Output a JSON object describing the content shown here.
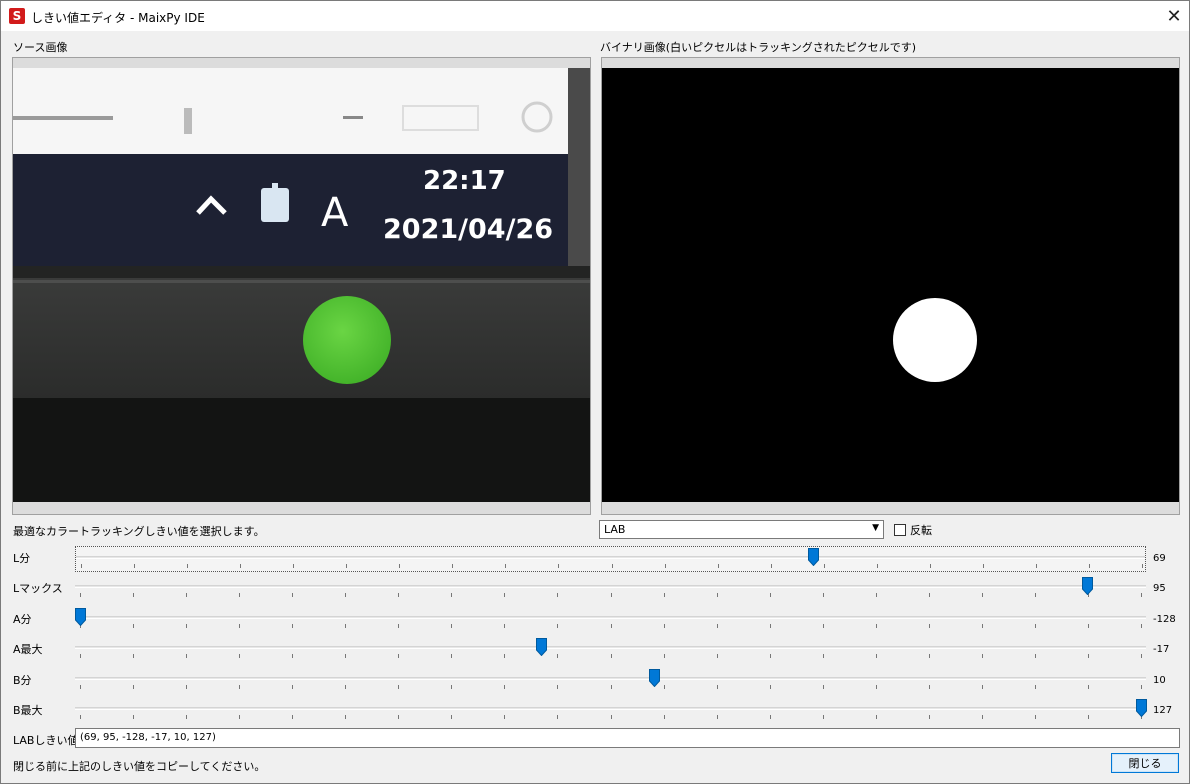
{
  "window": {
    "title": "しきい値エディタ - MaixPy IDE",
    "app_icon_letter": "S",
    "close_glyph": "✕"
  },
  "source_panel": {
    "label": "ソース画像",
    "clock_time": "22:17",
    "clock_date": "2021/04/26",
    "tray_letter": "A",
    "tray_chevron": "^"
  },
  "binary_panel": {
    "label": "バイナリ画像(白いピクセルはトラッキングされたピクセルです)"
  },
  "controls": {
    "hint": "最適なカラートラッキングしきい値を選択します。",
    "colorspace_selected": "LAB",
    "invert_label": "反転",
    "invert_checked": false
  },
  "sliders": [
    {
      "label": "L分",
      "value": "69",
      "min": 0,
      "max": 100,
      "num": 69
    },
    {
      "label": "Lマックス",
      "value": "95",
      "min": 0,
      "max": 100,
      "num": 95
    },
    {
      "label": "A分",
      "value": "-128",
      "min": -128,
      "max": 127,
      "num": -128
    },
    {
      "label": "A最大",
      "value": "-17",
      "min": -128,
      "max": 127,
      "num": -17
    },
    {
      "label": "B分",
      "value": "10",
      "min": -128,
      "max": 127,
      "num": 10
    },
    {
      "label": "B最大",
      "value": "127",
      "min": -128,
      "max": 127,
      "num": 127
    }
  ],
  "threshold": {
    "label": "LABしきい値",
    "value": "(69, 95, -128, -17, 10, 127)"
  },
  "footer": {
    "note": "閉じる前に上記のしきい値をコピーしてください。",
    "close_button": "閉じる"
  },
  "colors": {
    "accent": "#0078d7",
    "blob_green": "#5fcf3a",
    "binary_bg": "#000000",
    "binary_blob": "#ffffff"
  }
}
